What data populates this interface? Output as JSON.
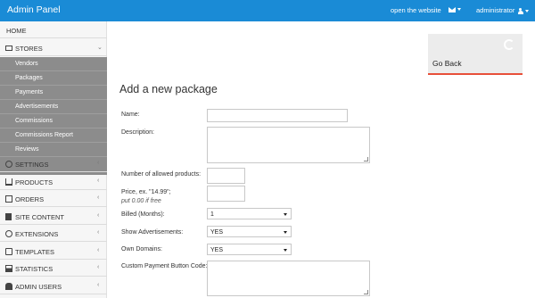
{
  "header": {
    "brand": "Admin Panel",
    "open_site": "open the website",
    "user": "administrator",
    "brand_color": "#1a8bd6"
  },
  "sidebar": {
    "home": "HOME",
    "stores": "STORES",
    "stores_sub": [
      "Vendors",
      "Packages",
      "Payments",
      "Advertisements",
      "Commissions",
      "Commissions Report",
      "Reviews"
    ],
    "items": [
      "SETTINGS",
      "PRODUCTS",
      "ORDERS",
      "SITE CONTENT",
      "EXTENSIONS",
      "TEMPLATES",
      "STATISTICS",
      "ADMIN USERS"
    ],
    "icons": [
      "store-icon",
      "gear-icon",
      "cart-icon",
      "orders-icon",
      "site-content-icon",
      "extensions-icon",
      "templates-icon",
      "statistics-icon",
      "users-icon"
    ]
  },
  "go_back": {
    "label": "Go Back",
    "accent": "#e8503a"
  },
  "page": {
    "title": "Add a new package"
  },
  "form": {
    "name_label": "Name:",
    "name_value": "",
    "description_label": "Description:",
    "description_value": "",
    "products_label": "Number of allowed products:",
    "products_value": "",
    "price_label": "Price, ex. \"14.99\";",
    "price_hint": "put 0.00 if free",
    "price_value": "",
    "billed_label": "Billed (Months):",
    "billed_value": "1",
    "ads_label": "Show Advertisements:",
    "ads_value": "YES",
    "domains_label": "Own Domains:",
    "domains_value": "YES",
    "payment_label": "Custom Payment Button Code:",
    "payment_value": ""
  }
}
